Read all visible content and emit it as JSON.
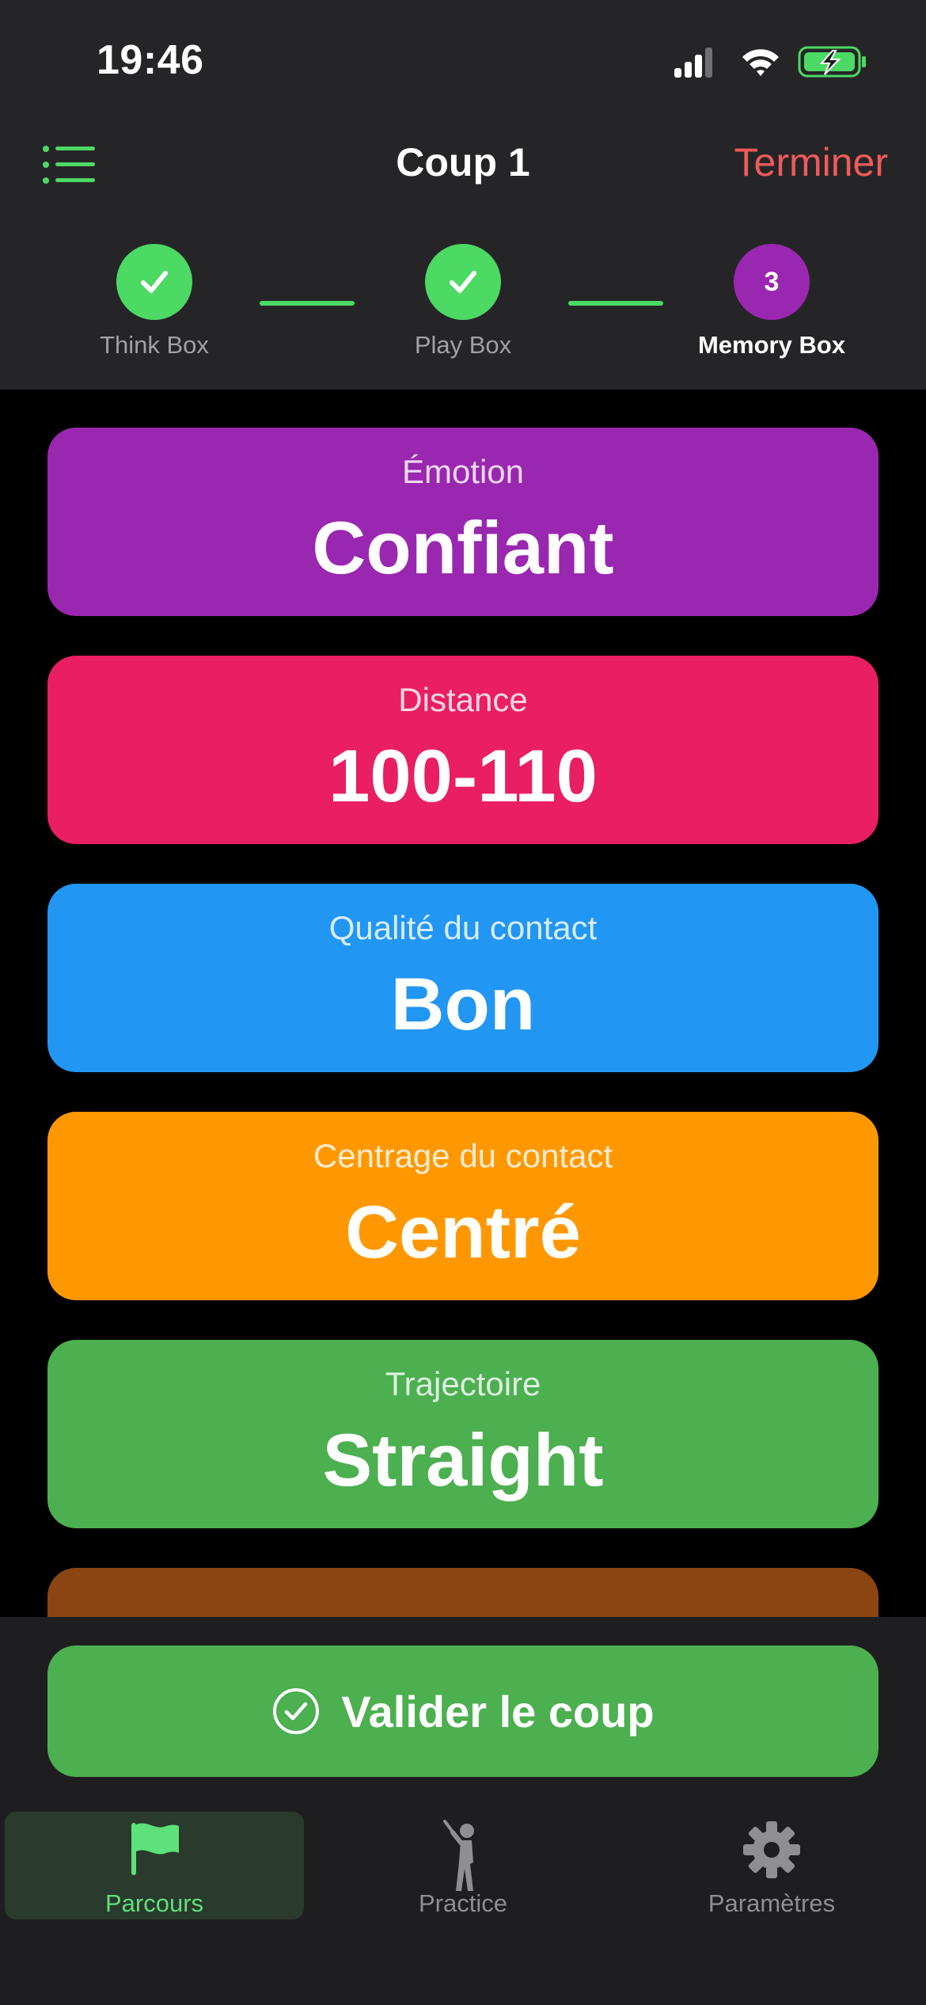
{
  "status_bar": {
    "time": "19:46"
  },
  "nav": {
    "title": "Coup 1",
    "finish_label": "Terminer"
  },
  "steps": [
    {
      "label": "Think Box",
      "state": "done"
    },
    {
      "label": "Play Box",
      "state": "done"
    },
    {
      "label": "Memory Box",
      "state": "current",
      "number": "3"
    }
  ],
  "cards": [
    {
      "caption": "Émotion",
      "value": "Confiant",
      "color": "#9a27b0"
    },
    {
      "caption": "Distance",
      "value": "100-110",
      "color": "#e91e63"
    },
    {
      "caption": "Qualité du contact",
      "value": "Bon",
      "color": "#2196f3"
    },
    {
      "caption": "Centrage du contact",
      "value": "Centré",
      "color": "#ff9800"
    },
    {
      "caption": "Trajectoire",
      "value": "Straight",
      "color": "#4caf50"
    },
    {
      "caption": "",
      "value": "",
      "color": "#8b4513"
    }
  ],
  "validate_button": {
    "label": "Valider le coup",
    "color": "#4caf50"
  },
  "tabs": [
    {
      "label": "Parcours",
      "icon": "flag-icon",
      "active": true
    },
    {
      "label": "Practice",
      "icon": "golfer-icon",
      "active": false
    },
    {
      "label": "Paramètres",
      "icon": "gear-icon",
      "active": false
    }
  ],
  "colors": {
    "accent_green": "#4cd964",
    "step_current": "#9a27b0",
    "finish_red": "#f05a5a",
    "header_bg": "#252527"
  }
}
